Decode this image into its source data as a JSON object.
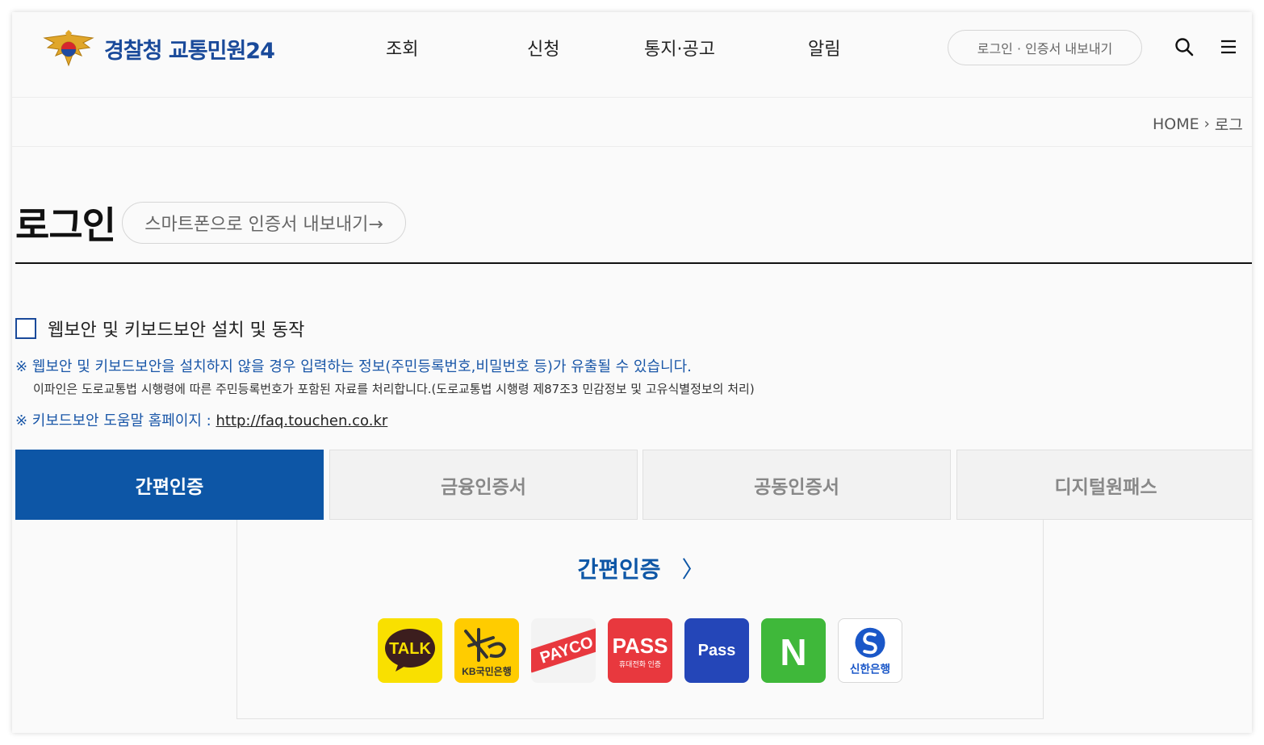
{
  "header": {
    "logo_text": "경찰청 교통민원24",
    "nav": [
      "조회",
      "신청",
      "통지·공고",
      "알림"
    ],
    "login_label": "로그인 · 인증서 내보내기"
  },
  "breadcrumb": {
    "home": "HOME",
    "current": "로그"
  },
  "page": {
    "title": "로그인",
    "export_label": "스마트폰으로 인증서 내보내기→"
  },
  "security": {
    "checkbox_label": "웹보안 및 키보드보안 설치 및 동작",
    "checked": false,
    "notice1": "※ 웹보안 및 키보드보안을 설치하지 않을 경우 입력하는 정보(주민등록번호,비밀번호 등)가 유출될 수 있습니다.",
    "notice2": "이파인은 도로교통법 시행령에 따른 주민등록번호가 포함된 자료를 처리합니다.(도로교통법 시행령 제87조3 민감정보 및 고유식별정보의 처리)",
    "notice3_prefix": "※ 키보드보안 도움말 홈페이지 : ",
    "notice3_link": "http://faq.touchen.co.kr"
  },
  "tabs": [
    {
      "label": "간편인증",
      "active": true
    },
    {
      "label": "금융인증서",
      "active": false
    },
    {
      "label": "공동인증서",
      "active": false
    },
    {
      "label": "디지털원패스",
      "active": false
    }
  ],
  "panel": {
    "title": "간편인증",
    "chevron": "〉",
    "providers": [
      {
        "name": "kakao",
        "label": "TALK",
        "bg": "#f9e000",
        "icon": "kakao-talk-icon"
      },
      {
        "name": "kb",
        "label": "KB국민은행",
        "bg": "#ffcc00",
        "icon": "kb-bank-icon"
      },
      {
        "name": "payco",
        "label": "PAYCO",
        "bg": "#f3f3f3",
        "icon": "payco-icon"
      },
      {
        "name": "pass",
        "label": "PASS",
        "sub": "휴대전화 인증",
        "bg": "#e8383e",
        "icon": "pass-icon"
      },
      {
        "name": "pass-blue",
        "label": "Pass",
        "bg": "#2446b8",
        "icon": "pass-blue-icon"
      },
      {
        "name": "naver",
        "label": "N",
        "bg": "#3fb83a",
        "icon": "naver-icon"
      },
      {
        "name": "shinhan",
        "label": "신한은행",
        "bg": "#ffffff",
        "icon": "shinhan-bank-icon"
      }
    ]
  },
  "colors": {
    "primary": "#0d56a6",
    "notice": "#1a57a8"
  }
}
